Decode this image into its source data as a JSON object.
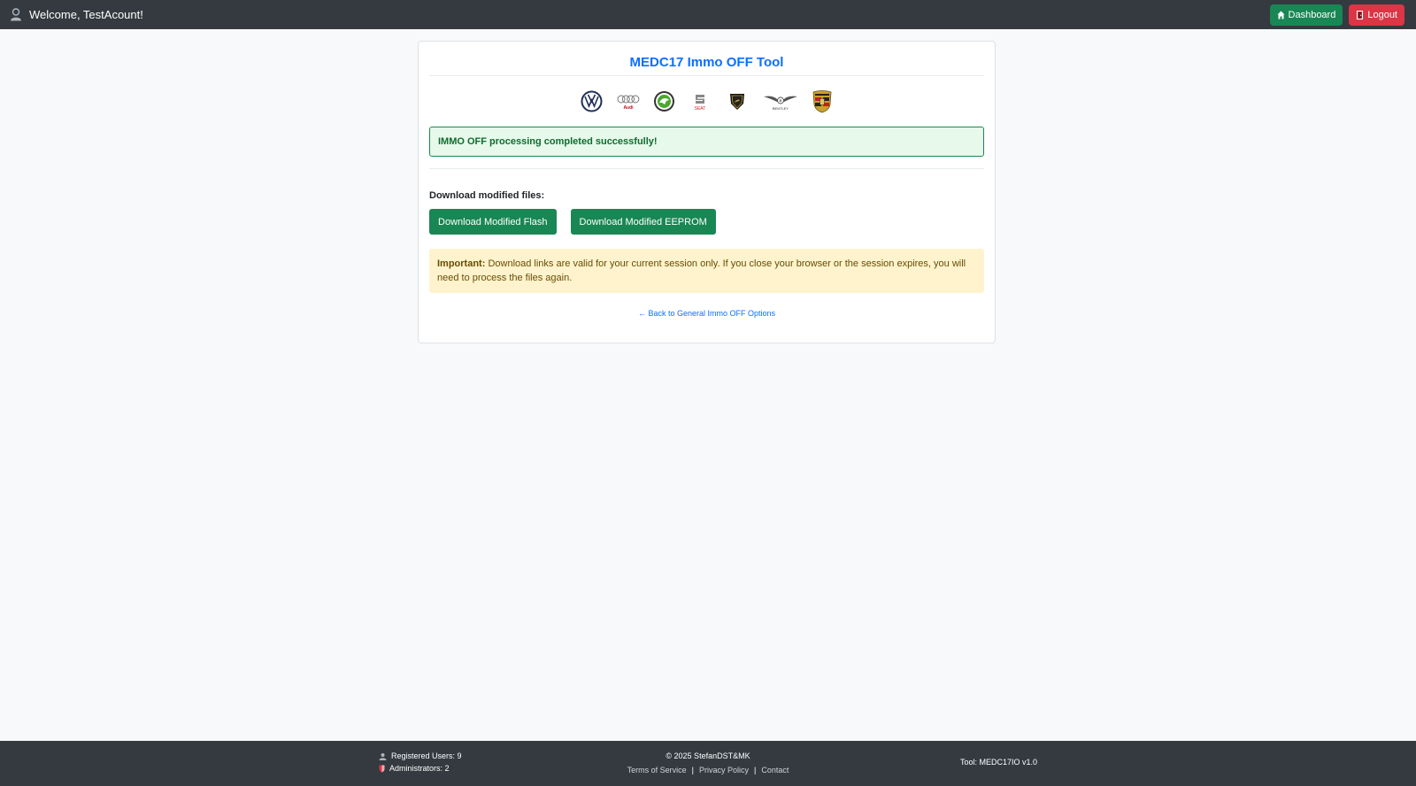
{
  "topbar": {
    "welcome": "Welcome, TestAcount!",
    "dashboard_label": "Dashboard",
    "logout_label": "Logout"
  },
  "card": {
    "title": "MEDC17 Immo OFF Tool",
    "logos": [
      "vw-logo-icon",
      "audi-logo-icon",
      "skoda-logo-icon",
      "seat-logo-icon",
      "lamborghini-logo-icon",
      "bentley-logo-icon",
      "porsche-logo-icon"
    ],
    "logo_texts": {
      "audi": "Audi",
      "seat": "SEAT",
      "bentley": "BENTLEY"
    },
    "success_message": "IMMO OFF processing completed successfully!",
    "download_label": "Download modified files:",
    "download_flash_label": "Download Modified Flash",
    "download_eeprom_label": "Download Modified EEPROM",
    "warning_bold": "Important:",
    "warning_text": " Download links are valid for your current session only. If you close your browser or the session expires, you will need to process the files again.",
    "back_link": "← Back to General Immo OFF Options"
  },
  "footer": {
    "registered_users": "Registered Users: 9",
    "administrators": "Administrators: 2",
    "copyright": "© 2025 StefanDST&MK",
    "links": [
      "Terms of Service",
      "Privacy Policy",
      "Contact"
    ],
    "separator": "|",
    "tool_version": "Tool: MEDC17IO v1.0"
  },
  "colors": {
    "navbar": "#343a40",
    "primary": "#0d6efd",
    "success": "#198754",
    "danger": "#dc3545",
    "warning_bg": "#fff3cd"
  }
}
